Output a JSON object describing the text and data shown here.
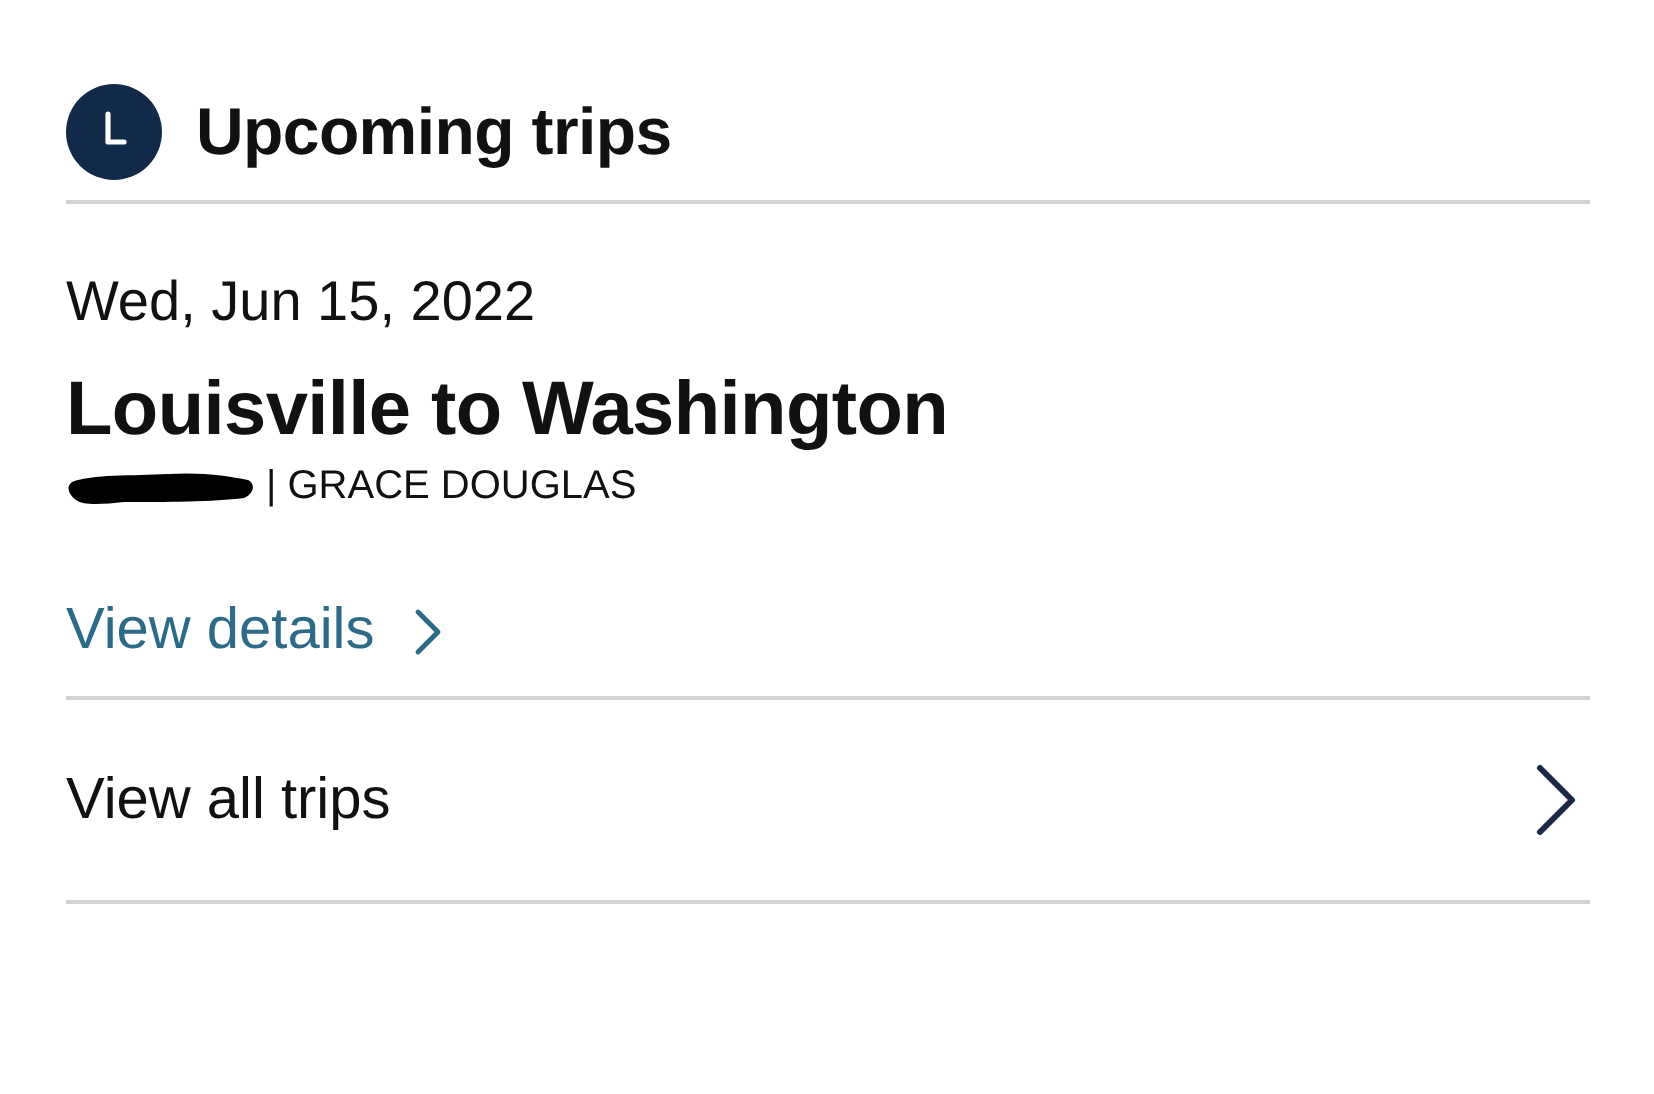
{
  "header": {
    "title": "Upcoming trips"
  },
  "trip": {
    "date": "Wed, Jun 15, 2022",
    "route": "Louisville to Washington",
    "passenger": "| GRACE DOUGLAS",
    "link": "View details"
  },
  "footer_link": {
    "label": "View all trips"
  }
}
